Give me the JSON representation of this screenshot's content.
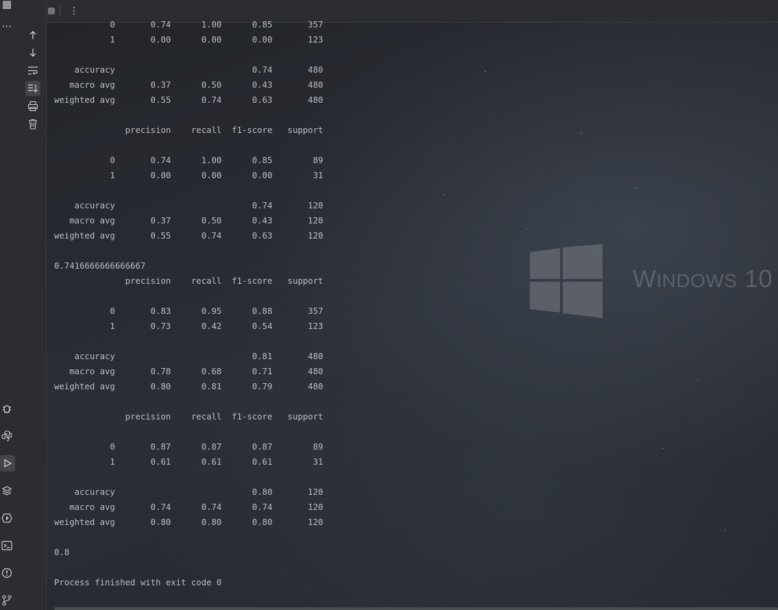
{
  "toolbar": {
    "rerun_icon": "rerun-icon",
    "stop_icon": "stop-icon",
    "more_icon": "more-vertical-icon"
  },
  "run_side": {
    "icons": [
      "arrow-up-icon",
      "arrow-down-icon",
      "soft-wrap-icon",
      "scroll-to-end-icon",
      "print-icon",
      "trash-icon"
    ]
  },
  "tool_strip": {
    "icons": [
      "structure-icon",
      "more-horizontal-icon",
      "debug-icon",
      "python-console-icon",
      "run-icon",
      "layers-icon",
      "services-icon",
      "terminal-icon",
      "problems-icon",
      "git-icon"
    ]
  },
  "console": {
    "lines": [
      "           0       0.74      1.00      0.85       357",
      "           1       0.00      0.00      0.00       123",
      "",
      "    accuracy                           0.74       480",
      "   macro avg       0.37      0.50      0.43       480",
      "weighted avg       0.55      0.74      0.63       480",
      "",
      "              precision    recall  f1-score   support",
      "",
      "           0       0.74      1.00      0.85        89",
      "           1       0.00      0.00      0.00        31",
      "",
      "    accuracy                           0.74       120",
      "   macro avg       0.37      0.50      0.43       120",
      "weighted avg       0.55      0.74      0.63       120",
      "",
      "0.7416666666666667",
      "              precision    recall  f1-score   support",
      "",
      "           0       0.83      0.95      0.88       357",
      "           1       0.73      0.42      0.54       123",
      "",
      "    accuracy                           0.81       480",
      "   macro avg       0.78      0.68      0.71       480",
      "weighted avg       0.80      0.81      0.79       480",
      "",
      "              precision    recall  f1-score   support",
      "",
      "           0       0.87      0.87      0.87        89",
      "           1       0.61      0.61      0.61        31",
      "",
      "    accuracy                           0.80       120",
      "   macro avg       0.74      0.74      0.74       120",
      "weighted avg       0.80      0.80      0.80       120",
      "",
      "0.8",
      "",
      "Process finished with exit code 0"
    ]
  },
  "wallpaper": {
    "brand_prefix": "W",
    "brand_rest": "INDOWS",
    "brand_version": "10"
  }
}
